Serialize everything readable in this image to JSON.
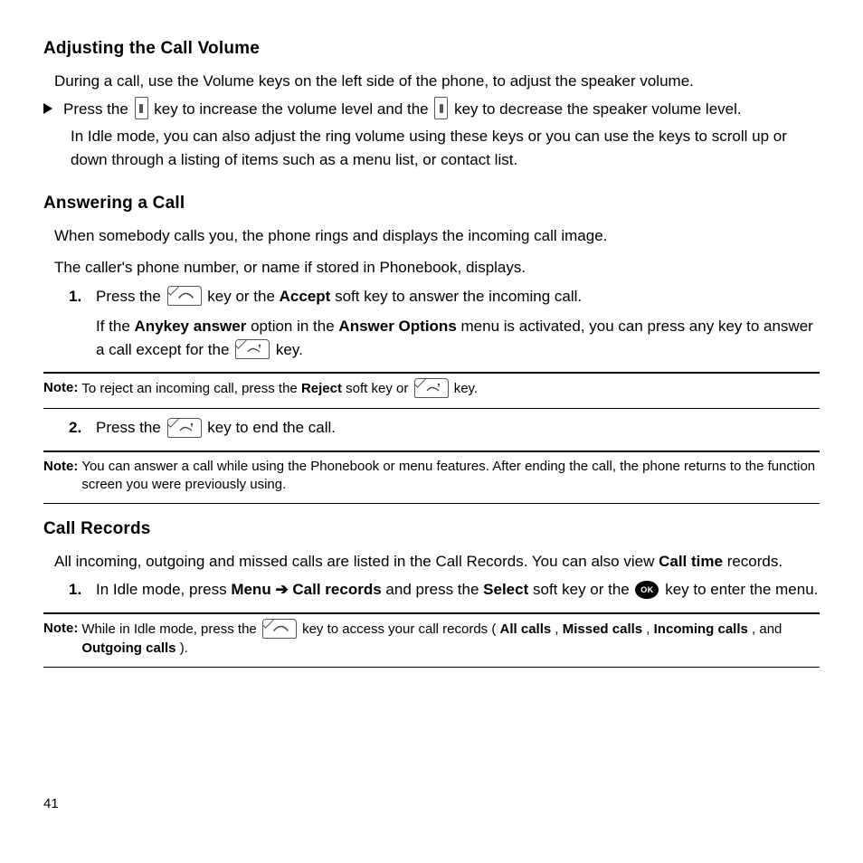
{
  "sec1": {
    "heading": "Adjusting the Call Volume",
    "p1": "During a call, use the Volume keys on the left side of the phone, to adjust the speaker volume.",
    "bullet_a": "Press the ",
    "bullet_b": " key to increase the volume level and the ",
    "bullet_c": " key to decrease the speaker volume level.",
    "bullet2": "In Idle mode, you can also adjust the ring volume using these keys or you can use the keys to scroll up or down through a listing of items such as a menu list, or contact list."
  },
  "sec2": {
    "heading": "Answering a Call",
    "p1": "When somebody calls you, the phone rings and displays the incoming call image.",
    "p2": "The caller's phone number, or name if stored in Phonebook, displays.",
    "step1_num": "1.",
    "step1_a": "Press the ",
    "step1_b": " key or the ",
    "step1_accept": "Accept",
    "step1_c": " soft key to answer the incoming call.",
    "step1_cont_a": "If the ",
    "step1_cont_anykey": "Anykey answer",
    "step1_cont_b": " option in the ",
    "step1_cont_ansopt": "Answer Options",
    "step1_cont_c": " menu is activated, you can press any key to answer a call except for the ",
    "step1_cont_d": " key.",
    "note1_label": "Note:",
    "note1_a": " To reject an incoming call, press the ",
    "note1_reject": "Reject",
    "note1_b": " soft key or ",
    "note1_c": " key.",
    "step2_num": "2.",
    "step2_a": "Press the ",
    "step2_b": " key to end the call.",
    "note2_label": "Note:",
    "note2": " You can answer a call while using the Phonebook or menu features. After ending the call, the phone returns to the function screen you were previously using."
  },
  "sec3": {
    "heading": "Call Records",
    "p1_a": "All incoming, outgoing and missed calls are listed in the Call Records. You can also view ",
    "p1_calltime": "Call time",
    "p1_b": " records.",
    "step1_num": "1.",
    "step1_a": "In Idle mode, press ",
    "step1_menu": "Menu",
    "step1_arrow": " ➔ ",
    "step1_callrec": "Call records",
    "step1_b": " and press the ",
    "step1_select": "Select",
    "step1_c": " soft key or the  ",
    "step1_d": "  key to enter the menu.",
    "note1_label": "Note:",
    "note1_a": " While in Idle mode, press the ",
    "note1_b": " key to access your call records (",
    "note1_all": "All calls",
    "note1_c1": ", ",
    "note1_missed": "Missed calls",
    "note1_c2": ", ",
    "note1_inc": "Incoming calls",
    "note1_c3": ", and ",
    "note1_out": "Outgoing calls",
    "note1_d": ")."
  },
  "ok_label": "OK",
  "page": "41"
}
